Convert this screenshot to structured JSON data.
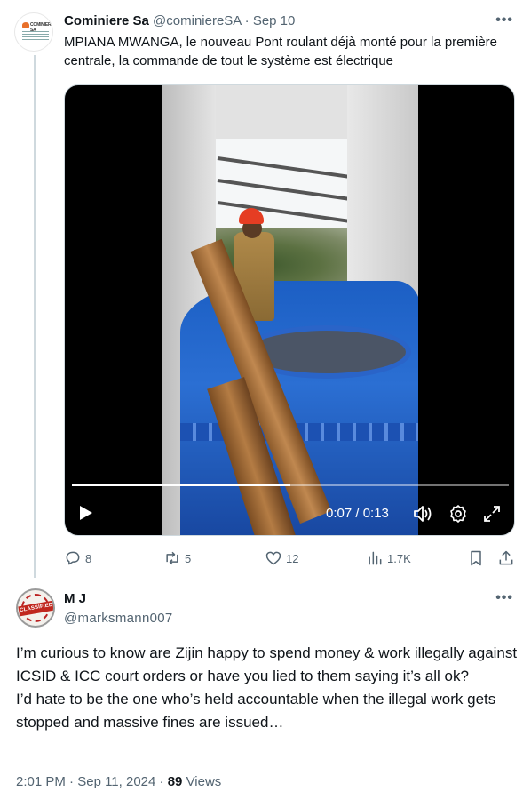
{
  "tweet1": {
    "name": "Cominiere Sa",
    "handle": "@cominiereSA",
    "separator": "·",
    "date": "Sep 10",
    "text": "MPIANA MWANGA,  le nouveau Pont roulant déjà monté pour la première centrale, la commande de tout le système est électrique",
    "avatar_logo_text": "COMINIERE SA",
    "video": {
      "time_display": "0:07 / 0:13",
      "progress": 0.5,
      "icons": [
        "play-icon",
        "volume-icon",
        "gear-icon",
        "expand-icon"
      ]
    },
    "actions": {
      "replies": "8",
      "reposts": "5",
      "likes": "12",
      "views": "1.7K"
    }
  },
  "tweet2": {
    "name": "M J",
    "handle": "@marksmann007",
    "avatar_stamp_text": "CLASSIFIED",
    "text_lines": [
      "I’m curious to know are Zijin happy to spend money & work illegally against ICSID & ICC court orders or have you lied to them saying it’s all ok?",
      "I’d hate to be the one who’s held accountable when the illegal work gets stopped and massive fines are issued…"
    ],
    "time": "2:01 PM",
    "separator": "·",
    "date": "Sep 11, 2024",
    "views_count": "89",
    "views_label": "Views"
  },
  "colors": {
    "text_primary": "#0f1419",
    "text_secondary": "#536471",
    "thread_line": "#cfd9de"
  }
}
